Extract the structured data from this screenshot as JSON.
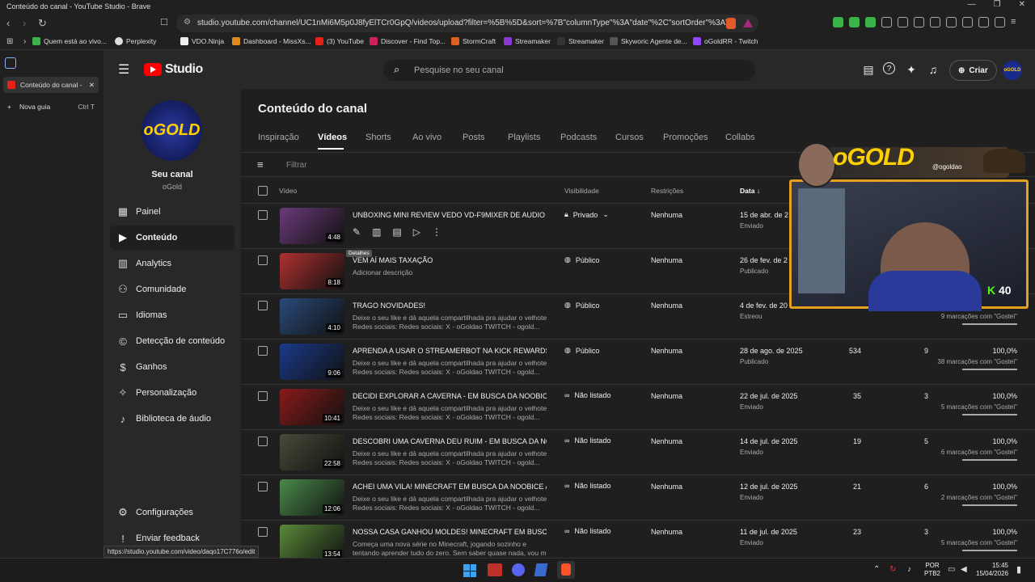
{
  "window": {
    "title": "Conteúdo do canal - YouTube Studio - Brave",
    "url": "studio.youtube.com/channel/UC1nMi6M5p0J8fyElTCr0GpQ/videos/upload?filter=%5B%5D&sort=%7B\"columnType\"%3A\"date\"%2C\"sortOrder\"%3A\"..."
  },
  "bookmarks": [
    {
      "label": "Quem está ao vivo..."
    },
    {
      "label": "Perplexity"
    },
    {
      "label": "VDO.Ninja"
    },
    {
      "label": "Dashboard - MissXs..."
    },
    {
      "label": "(3) YouTube"
    },
    {
      "label": "Discover - Find Top..."
    },
    {
      "label": "StormCraft"
    },
    {
      "label": "Streamaker"
    },
    {
      "label": "Streamaker"
    },
    {
      "label": "Skyworic Agente de..."
    },
    {
      "label": "oGoldRR - Twitch"
    }
  ],
  "tabs": {
    "active": "Conteúdo do canal -",
    "new_tab": "Nova guia",
    "new_tab_shortcut": "Ctrl T"
  },
  "studio": {
    "logo": "Studio",
    "search_placeholder": "Pesquise no seu canal",
    "create_label": "Criar",
    "avatar_text": "oGOLD"
  },
  "channel": {
    "avatar_text": "oGOLD",
    "label": "Seu canal",
    "name": "oGold"
  },
  "nav": [
    {
      "label": "Painel",
      "icon": "dashboard-icon"
    },
    {
      "label": "Conteúdo",
      "icon": "content-icon"
    },
    {
      "label": "Analytics",
      "icon": "analytics-icon"
    },
    {
      "label": "Comunidade",
      "icon": "community-icon"
    },
    {
      "label": "Idiomas",
      "icon": "subtitles-icon"
    },
    {
      "label": "Detecção de conteúdo",
      "icon": "copyright-icon"
    },
    {
      "label": "Ganhos",
      "icon": "dollar-icon"
    },
    {
      "label": "Personalização",
      "icon": "wand-icon"
    },
    {
      "label": "Biblioteca de áudio",
      "icon": "audio-library-icon"
    }
  ],
  "nav_bottom": [
    {
      "label": "Configurações",
      "icon": "gear-icon"
    },
    {
      "label": "Enviar feedback",
      "icon": "feedback-icon"
    }
  ],
  "page": {
    "title": "Conteúdo do canal",
    "tabs": [
      "Inspiração",
      "Vídeos",
      "Shorts",
      "Ao vivo",
      "Posts",
      "Playlists",
      "Podcasts",
      "Cursos",
      "Promoções",
      "Collabs"
    ],
    "active_tab": "Vídeos",
    "filter_placeholder": "Filtrar",
    "columns": {
      "video": "Vídeo",
      "visibility": "Visibilidade",
      "restrictions": "Restrições",
      "date": "Data"
    },
    "tooltip": "Detalhes"
  },
  "videos": [
    {
      "title": "UNBOXING MINI REVIEW VEDO VD-F9MIXER DE AUDIO",
      "desc1": "",
      "desc2": "",
      "duration": "4:48",
      "visibility": "Privado",
      "restriction": "Nenhuma",
      "date": "15 de abr. de 2",
      "status": "Enviado",
      "views": "",
      "comments": "",
      "likes_pct": "",
      "likes_note": "",
      "thumb_color": "#6a3a7a"
    },
    {
      "title": "VEM AÍ MAIS TAXAÇÃO",
      "desc1": "Adicionar descrição",
      "desc2": "",
      "duration": "8:18",
      "visibility": "Público",
      "restriction": "Nenhuma",
      "date": "26 de fev. de 2",
      "status": "Publicado",
      "views": "",
      "comments": "",
      "likes_pct": "",
      "likes_note": "",
      "thumb_color": "#b03030"
    },
    {
      "title": "TRAGO NOVIDADES!",
      "desc1": "Deixe o seu like e dá aquela compartilhada pra ajudar o velhote!!",
      "desc2": "Redes sociais: Redes sociais: X - oGoldao TWITCH - ogold...",
      "duration": "4:10",
      "visibility": "Público",
      "restriction": "Nenhuma",
      "date": "4 de fev. de 20",
      "status": "Estreou",
      "views": "",
      "comments": "",
      "likes_pct": "",
      "likes_note": "9 marcações com \"Gostei\"",
      "thumb_color": "#2a4a7a"
    },
    {
      "title": "APRENDA A USAR O STREAMERBOT NA KICK REWARDS C...",
      "desc1": "Deixe o seu like e dá aquela compartilhada pra ajudar o velhote!!",
      "desc2": "Redes sociais: Redes sociais: X - oGoldao TWITCH - ogold...",
      "duration": "9:06",
      "visibility": "Público",
      "restriction": "Nenhuma",
      "date": "28 de ago. de 2025",
      "status": "Publicado",
      "views": "534",
      "comments": "9",
      "likes_pct": "100,0%",
      "likes_note": "38 marcações com \"Gostei\"",
      "thumb_color": "#1a3a8a"
    },
    {
      "title": "DECIDI EXPLORAR A CAVERNA - EM BUSCA DA NOOBICE A...",
      "desc1": "Deixe o seu like e dá aquela compartilhada pra ajudar o velhote!!",
      "desc2": "Redes sociais: Redes sociais: X - oGoldao TWITCH - ogold...",
      "duration": "10:41",
      "visibility": "Não listado",
      "restriction": "Nenhuma",
      "date": "22 de jul. de 2025",
      "status": "Enviado",
      "views": "35",
      "comments": "3",
      "likes_pct": "100,0%",
      "likes_note": "5 marcações com \"Gostei\"",
      "thumb_color": "#8a1a1a"
    },
    {
      "title": "DESCOBRI UMA CAVERNA DEU RUIM - EM BUSCA DA NOO...",
      "desc1": "Deixe o seu like e dá aquela compartilhada pra ajudar o velhote!!",
      "desc2": "Redes sociais: Redes sociais: X - oGoldao TWITCH - ogold...",
      "duration": "22:58",
      "visibility": "Não listado",
      "restriction": "Nenhuma",
      "date": "14 de jul. de 2025",
      "status": "Enviado",
      "views": "19",
      "comments": "5",
      "likes_pct": "100,0%",
      "likes_note": "6 marcações com \"Gostei\"",
      "thumb_color": "#4a4a3a"
    },
    {
      "title": "ACHEI UMA VILA! MINECRAFT EM BUSCA DA NOOBICE AU...",
      "desc1": "Deixe o seu like e dá aquela compartilhada pra ajudar o velhote!!",
      "desc2": "Redes sociais: Redes sociais: X - oGoldao TWITCH - ogold...",
      "duration": "12:06",
      "visibility": "Não listado",
      "restriction": "Nenhuma",
      "date": "12 de jul. de 2025",
      "status": "Enviado",
      "views": "21",
      "comments": "6",
      "likes_pct": "100,0%",
      "likes_note": "2 marcações com \"Gostei\"",
      "thumb_color": "#4a8a4a"
    },
    {
      "title": "NOSSA CASA GANHOU MOLDES! MINECRAFT EM BUSCA ...",
      "desc1": "Começa uma nova série no Minecraft, jogando sozinho e",
      "desc2": "tentando aprender tudo do zero. Sem saber quase nada, vou m...",
      "duration": "13:54",
      "visibility": "Não listado",
      "restriction": "Nenhuma",
      "date": "11 de jul. de 2025",
      "status": "Enviado",
      "views": "23",
      "comments": "3",
      "likes_pct": "100,0%",
      "likes_note": "5 marcações com \"Gostei\"",
      "thumb_color": "#5a8a3a"
    }
  ],
  "overlay": {
    "logo": "oGOLD",
    "handle": "@ogoldao",
    "kick_badge": "40"
  },
  "status_url": "https://studio.youtube.com/video/daqo17C776o/edit",
  "taskbar": {
    "lang1": "POR",
    "lang2": "PTB2",
    "time": "15:45",
    "date": "15/04/2026"
  }
}
